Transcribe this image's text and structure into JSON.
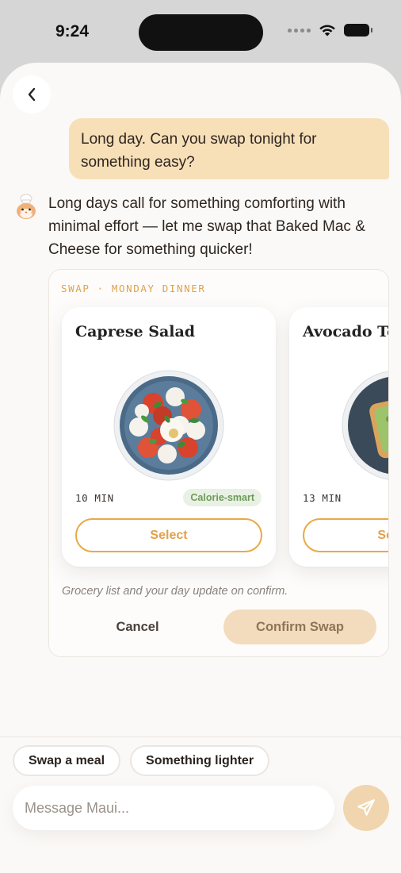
{
  "status_bar": {
    "time": "9:24"
  },
  "chat": {
    "user_message": "Long day. Can you swap tonight for something easy?",
    "assistant_message": "Long days call for something comforting with minimal effort — let me swap that Baked Mac & Cheese for something quicker!"
  },
  "swap_card": {
    "label": "SWAP · MONDAY DINNER",
    "meals": [
      {
        "title": "Caprese Salad",
        "time": "10 MIN",
        "tag": "Calorie-smart",
        "select_label": "Select"
      },
      {
        "title": "Avocado Toast",
        "time": "13 MIN",
        "select_label": "Select"
      }
    ],
    "note": "Grocery list and your day update on confirm.",
    "cancel_label": "Cancel",
    "confirm_label": "Confirm Swap"
  },
  "quick_replies": [
    "Swap a meal",
    "Something lighter"
  ],
  "composer": {
    "placeholder": "Message Maui..."
  },
  "colors": {
    "accent": "#e8a948",
    "user_bubble": "#f7dfb8",
    "tag_bg": "#e8f1e3",
    "tag_text": "#6f9a5c",
    "send_button": "#f0d5ae"
  },
  "icons": {
    "back": "chevron-left-icon",
    "send": "paper-plane-icon",
    "avatar": "chef-hamster-avatar"
  }
}
